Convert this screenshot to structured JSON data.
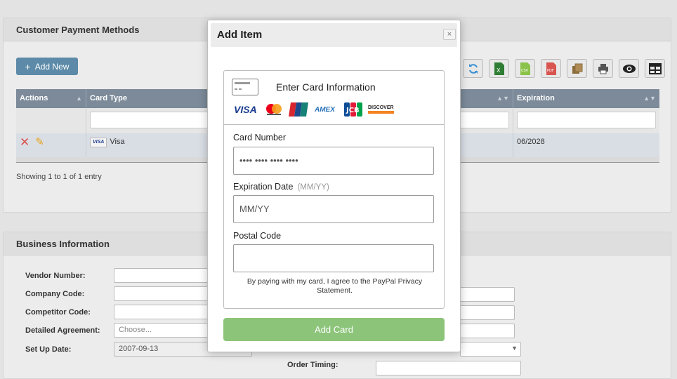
{
  "payments_panel": {
    "title": "Customer Payment Methods",
    "add_new": "Add New",
    "columns": [
      "Actions",
      "Card Type",
      "Expiration"
    ],
    "row": {
      "card_brand": "VISA",
      "card_type": "Visa",
      "expiration": "06/2028"
    },
    "showing": "Showing 1 to 1 of 1 entry",
    "toolbar_icons": [
      "refresh-icon",
      "excel-icon",
      "csv-icon",
      "pdf-icon",
      "copy-icon",
      "print-icon",
      "eye-icon",
      "columns-icon"
    ]
  },
  "business_panel": {
    "title": "Business Information",
    "fields": [
      {
        "label": "Vendor Number:",
        "value": ""
      },
      {
        "label": "Company Code:",
        "value": ""
      },
      {
        "label": "Competitor Code:",
        "value": ""
      },
      {
        "label": "Detailed Agreement:",
        "value": "Choose..."
      },
      {
        "label": "Set Up Date:",
        "value": "2007-09-13"
      }
    ],
    "order_timing_label": "Order Timing:"
  },
  "modal": {
    "title": "Add Item",
    "close": "×",
    "card_header": "Enter Card Information",
    "card_brands": [
      "VISA",
      "Mastercard",
      "UnionPay",
      "AMEX",
      "JCB",
      "DISCOVER"
    ],
    "card_number_label": "Card Number",
    "card_number_placeholder": "•••• •••• •••• ••••",
    "expiration_label": "Expiration Date",
    "expiration_hint": "(MM/YY)",
    "expiration_placeholder": "MM/YY",
    "postal_label": "Postal Code",
    "postal_placeholder": "",
    "agreement": "By paying with my card, I agree to the PayPal Privacy Statement.",
    "submit": "Add Card"
  },
  "colors": {
    "primary_button": "#5c8aa8",
    "grid_header": "#7c8a99",
    "add_card_button": "#8cc47a",
    "delete_icon": "#d9534f",
    "edit_icon": "#e8a317"
  }
}
